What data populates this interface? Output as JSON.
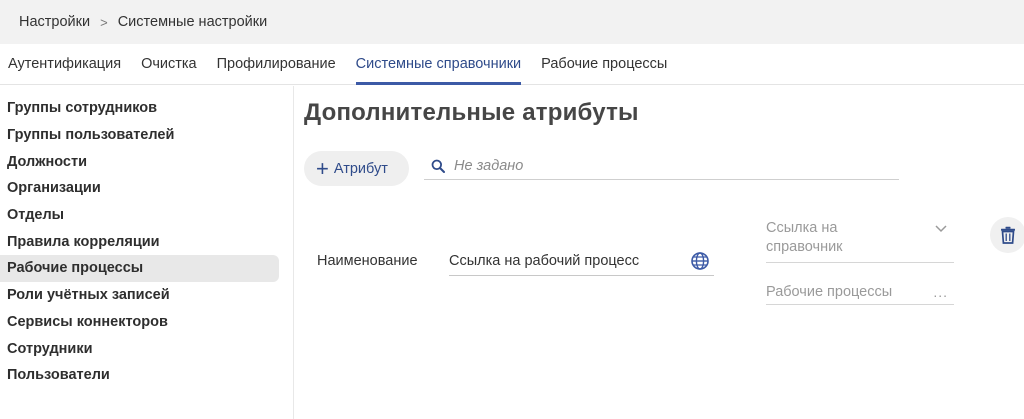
{
  "breadcrumb": {
    "items": [
      "Настройки",
      "Системные настройки"
    ],
    "separator": ">"
  },
  "tabs": [
    {
      "label": "Аутентификация",
      "active": false
    },
    {
      "label": "Очистка",
      "active": false
    },
    {
      "label": "Профилирование",
      "active": false
    },
    {
      "label": "Системные справочники",
      "active": true
    },
    {
      "label": "Рабочие процессы",
      "active": false
    }
  ],
  "sidebar": {
    "items": [
      {
        "label": "Группы сотрудников",
        "active": false
      },
      {
        "label": "Группы пользователей",
        "active": false
      },
      {
        "label": "Должности",
        "active": false
      },
      {
        "label": "Организации",
        "active": false
      },
      {
        "label": "Отделы",
        "active": false
      },
      {
        "label": "Правила корреляции",
        "active": false
      },
      {
        "label": "Рабочие процессы",
        "active": true
      },
      {
        "label": "Роли учётных записей",
        "active": false
      },
      {
        "label": "Сервисы коннекторов",
        "active": false
      },
      {
        "label": "Сотрудники",
        "active": false
      },
      {
        "label": "Пользователи",
        "active": false
      }
    ]
  },
  "main": {
    "title": "Дополнительные атрибуты",
    "add_button": {
      "icon": "plus-icon",
      "label": "Атрибут"
    },
    "search": {
      "icon": "search-icon",
      "value": "",
      "placeholder": "Не задано"
    },
    "attribute_row": {
      "label": "Наименование",
      "name_value": "Ссылка на рабочий процесс",
      "name_icon": "globe-icon",
      "reference_select": {
        "placeholder": "Ссылка на справочник",
        "icon": "chevron-down-icon"
      },
      "workflow_field": {
        "placeholder": "Рабочие процессы",
        "more": "..."
      },
      "delete_icon": "trash-icon"
    }
  },
  "colors": {
    "accent": "#3c5aa6",
    "accent_text": "#2f4b8a",
    "breadcrumb_bg": "#f2f2f2",
    "active_item_bg": "#e8e8e8",
    "button_bg": "#efefef"
  }
}
